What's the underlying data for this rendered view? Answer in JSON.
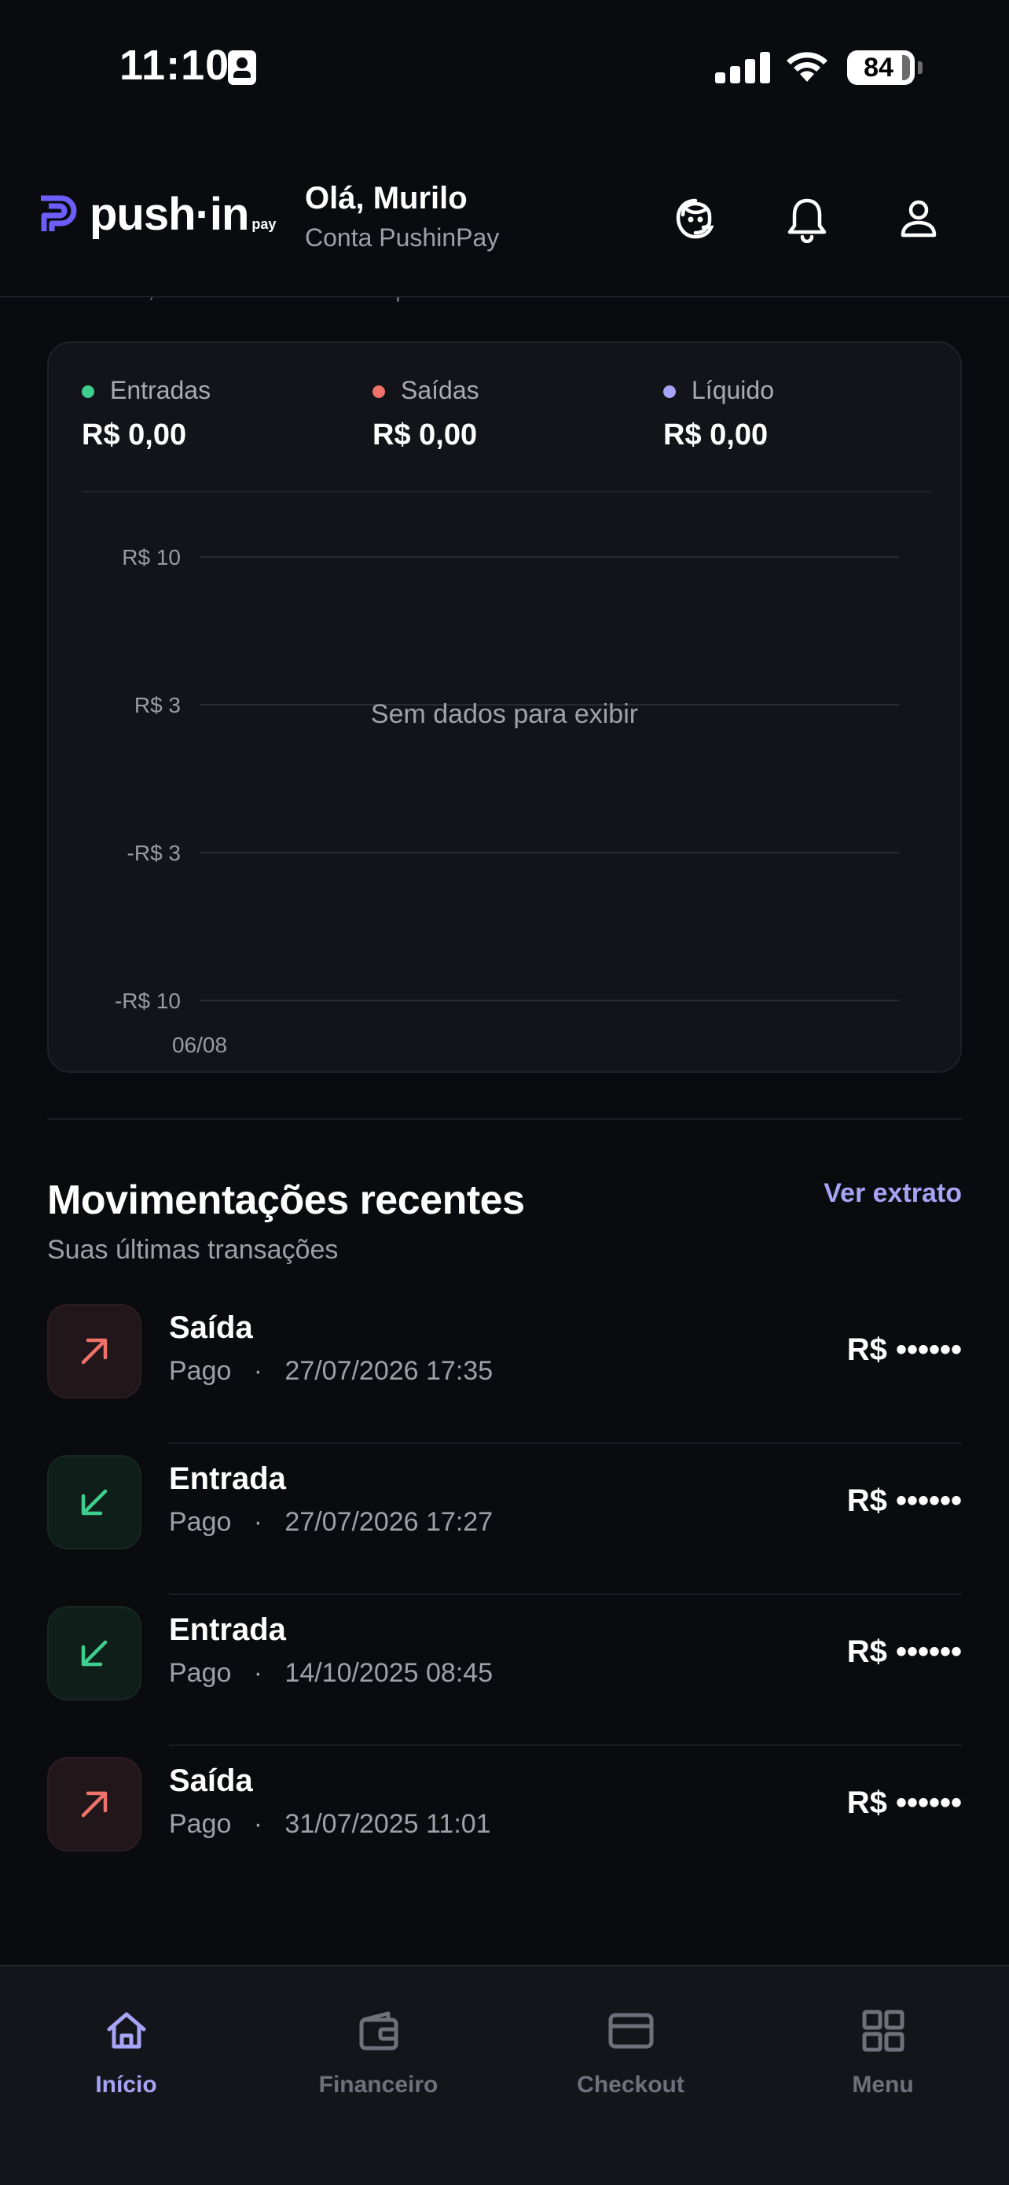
{
  "status_bar": {
    "time": "11:10",
    "battery": "84"
  },
  "header": {
    "logo_text": "push·in",
    "logo_suffix": "pay",
    "greeting": "Olá, Murilo",
    "account": "Conta PushinPay",
    "icons": [
      "support-icon",
      "bell-icon",
      "profile-icon"
    ]
  },
  "summary": {
    "subtitle_partial": "Entradas, saídas e resultado líquido",
    "legend": [
      {
        "label": "Entradas",
        "value": "R$ 0,00",
        "color": "#3ecf8e"
      },
      {
        "label": "Saídas",
        "value": "R$ 0,00",
        "color": "#f0736b"
      },
      {
        "label": "Líquido",
        "value": "R$ 0,00",
        "color": "#a7a3f5"
      }
    ]
  },
  "chart_data": {
    "type": "line",
    "y_ticks": [
      "R$ 10",
      "R$ 3",
      "-R$ 3",
      "-R$ 10"
    ],
    "x_ticks": [
      "06/08"
    ],
    "empty_message": "Sem dados para exibir",
    "series": []
  },
  "movements": {
    "title": "Movimentações recentes",
    "subtitle": "Suas últimas transações",
    "link": "Ver extrato",
    "items": [
      {
        "type": "Saída",
        "status": "Pago",
        "datetime": "27/07/2026 17:35",
        "amount": "R$ ••••••",
        "direction": "out"
      },
      {
        "type": "Entrada",
        "status": "Pago",
        "datetime": "27/07/2026 17:27",
        "amount": "R$ ••••••",
        "direction": "in"
      },
      {
        "type": "Entrada",
        "status": "Pago",
        "datetime": "14/10/2025 08:45",
        "amount": "R$ ••••••",
        "direction": "in"
      },
      {
        "type": "Saída",
        "status": "Pago",
        "datetime": "31/07/2025 11:01",
        "amount": "R$ ••••••",
        "direction": "out"
      }
    ]
  },
  "nav": [
    {
      "label": "Início",
      "icon": "home-icon",
      "active": true
    },
    {
      "label": "Financeiro",
      "icon": "wallet-icon",
      "active": false
    },
    {
      "label": "Checkout",
      "icon": "card-icon",
      "active": false
    },
    {
      "label": "Menu",
      "icon": "grid-icon",
      "active": false
    }
  ],
  "colors": {
    "accent": "#a7a3f5",
    "in": "#3ecf8e",
    "out": "#f0736b",
    "background": "#0a0b0f"
  }
}
